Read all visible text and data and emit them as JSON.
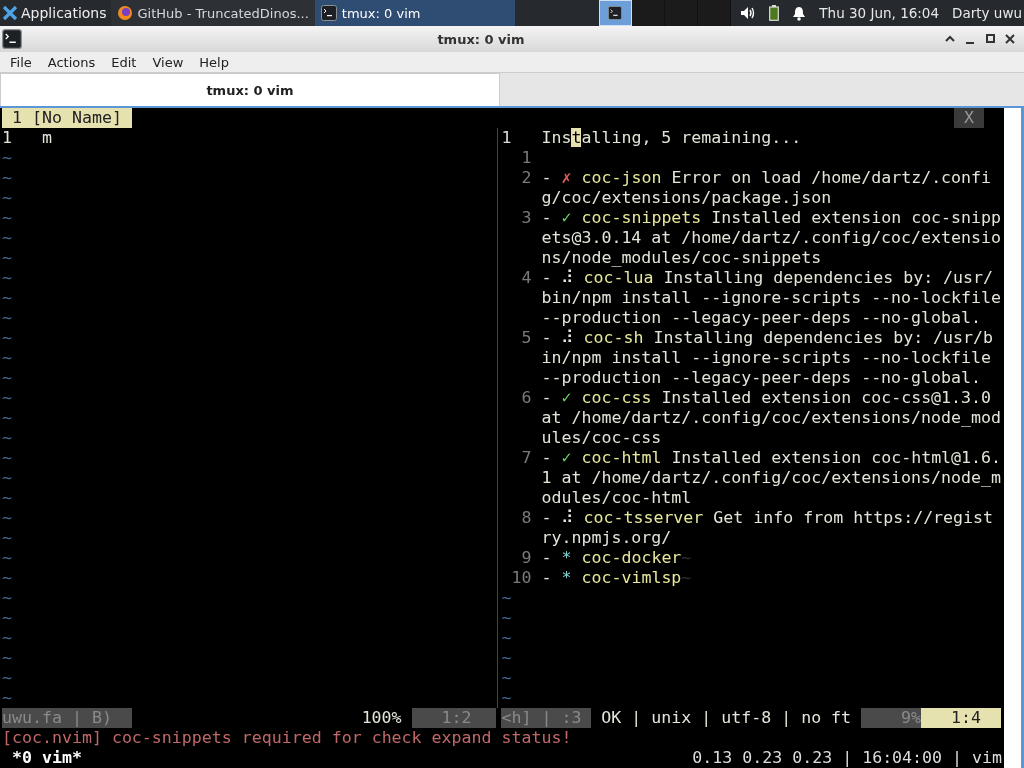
{
  "taskbar": {
    "apps_menu": "Applications",
    "tasks": [
      {
        "title": "GitHub - TruncatedDinos...",
        "kind": "browser",
        "selected": false
      },
      {
        "title": "tmux: 0 vim",
        "kind": "terminal",
        "selected": true
      }
    ],
    "workspaces": [
      {
        "selected": true
      },
      {
        "selected": false
      },
      {
        "selected": false
      },
      {
        "selected": false
      }
    ],
    "clock": "Thu 30 Jun, 16:04",
    "user": "Darty uwu"
  },
  "window": {
    "title": "tmux: 0 vim",
    "menu": [
      "File",
      "Actions",
      "Edit",
      "View",
      "Help"
    ],
    "tabs": [
      {
        "label": "tmux: 0 vim",
        "selected": true
      }
    ]
  },
  "vim": {
    "tabline": {
      "label": "1 [No Name]",
      "close": "X"
    },
    "left_pane": {
      "lines": [
        {
          "number": "1",
          "text": "m"
        }
      ],
      "filler": [
        "~",
        "~",
        "~",
        "~",
        "~",
        "~",
        "~",
        "~",
        "~",
        "~",
        "~",
        "~",
        "~",
        "~",
        "~",
        "~",
        "~",
        "~",
        "~",
        "~",
        "~",
        "~",
        "~",
        "~",
        "~",
        "~",
        "~",
        "~"
      ]
    },
    "right_pane": {
      "header": {
        "number": "1",
        "before": "Ins",
        "cursor": "t",
        "after": "alling, 5 remaining..."
      },
      "blank_number": "1",
      "lines": [
        {
          "number": "2",
          "kind": "error",
          "prefix": "-",
          "mark": "✗",
          "name": "coc-json",
          "text": "Error on load /home/dartz/.config/coc/extensions/package.json"
        },
        {
          "number": "3",
          "kind": "done",
          "prefix": "-",
          "mark": "✓",
          "name": "coc-snippets",
          "text": "Installed extension coc-snippets@3.0.14 at /home/dartz/.config/coc/extensions/node_modules/coc-snippets"
        },
        {
          "number": "4",
          "kind": "progress",
          "prefix": "-",
          "mark": "⠼",
          "name": "coc-lua",
          "text": "Installing dependencies by: /usr/bin/npm install --ignore-scripts --no-lockfile --production --legacy-peer-deps --no-global."
        },
        {
          "number": "5",
          "kind": "progress",
          "prefix": "-",
          "mark": "⠼",
          "name": "coc-sh",
          "text": "Installing dependencies by: /usr/bin/npm install --ignore-scripts --no-lockfile --production --legacy-peer-deps --no-global."
        },
        {
          "number": "6",
          "kind": "done",
          "prefix": "-",
          "mark": "✓",
          "name": "coc-css",
          "text": "Installed extension coc-css@1.3.0 at /home/dartz/.config/coc/extensions/node_modules/coc-css"
        },
        {
          "number": "7",
          "kind": "done",
          "prefix": "-",
          "mark": "✓",
          "name": "coc-html",
          "text": "Installed extension coc-html@1.6.1 at /home/dartz/.config/coc/extensions/node_modules/coc-html"
        },
        {
          "number": "8",
          "kind": "progress",
          "prefix": "-",
          "mark": "⠼",
          "name": "coc-tsserver",
          "text": "Get info from https://registry.npmjs.org/"
        },
        {
          "number": "9",
          "kind": "pending",
          "prefix": "-",
          "mark": "*",
          "name": "coc-docker",
          "trail": "~"
        },
        {
          "number": "10",
          "kind": "pending",
          "prefix": "-",
          "mark": "*",
          "name": "coc-vimlsp",
          "trail": "~"
        }
      ],
      "filler": [
        "~",
        "~",
        "~",
        "~",
        "~",
        "~"
      ]
    },
    "statusline": {
      "left_file": "uwu.fa | B)",
      "left_percent": "100%",
      "left_position": "1:2",
      "right_mode": "<h] | :3",
      "right_info": "OK | unix | utf-8 | no ft",
      "right_percent": "9%",
      "right_position": "1:4"
    },
    "message": "[coc.nvim] coc-snippets required for check expand status!"
  },
  "tmux_status": {
    "window": "*0 vim*",
    "right": "0.13 0.23 0.23 | 16:04:00 | vim"
  }
}
